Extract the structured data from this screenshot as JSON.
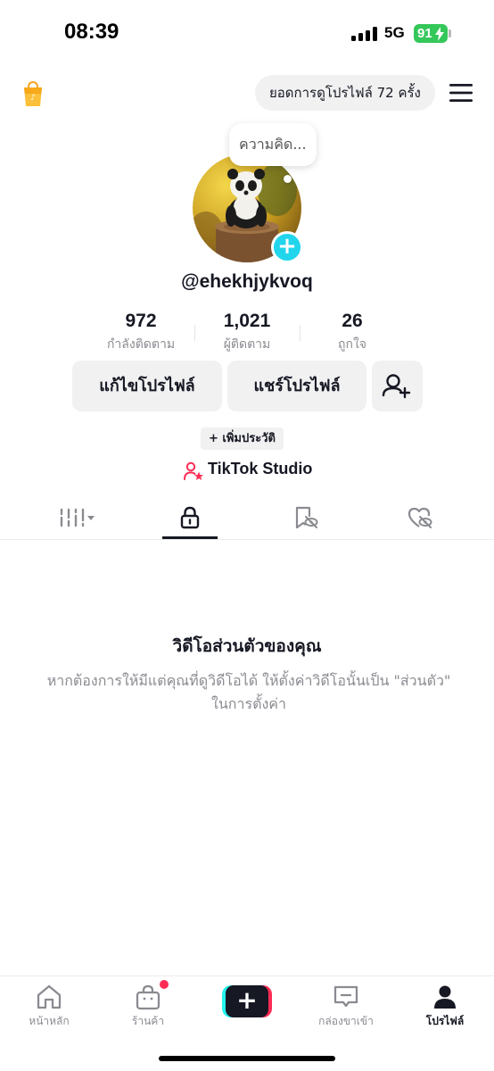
{
  "status_bar": {
    "time": "08:39",
    "network": "5G",
    "battery": "91"
  },
  "header": {
    "profile_views": "ยอดการดูโปรไฟล์ 72 ครั้ง"
  },
  "profile": {
    "thought_bubble": "ความคิด...",
    "username": "@ehekhjykvoq",
    "stats": [
      {
        "value": "972",
        "label": "กำลังติดตาม"
      },
      {
        "value": "1,021",
        "label": "ผู้ติดตาม"
      },
      {
        "value": "26",
        "label": "ถูกใจ"
      }
    ],
    "edit_profile_label": "แก้ไขโปรไฟล์",
    "share_profile_label": "แชร์โปรไฟล์",
    "add_bio_label": "+ เพิ่มประวัติ",
    "studio_label": "TikTok Studio"
  },
  "tabs": [
    {
      "icon": "grid-filter-icon",
      "active": false
    },
    {
      "icon": "lock-icon",
      "active": true
    },
    {
      "icon": "bookmark-hidden-icon",
      "active": false
    },
    {
      "icon": "heart-hidden-icon",
      "active": false
    }
  ],
  "empty_state": {
    "title": "วิดีโอส่วนตัวของคุณ",
    "description": "หากต้องการให้มีแต่คุณที่ดูวิดีโอได้ ให้ตั้งค่าวิดีโอนั้นเป็น \"ส่วนตัว\" ในการตั้งค่า"
  },
  "bottom_nav": {
    "items": [
      {
        "label": "หน้าหลัก",
        "icon": "home-icon"
      },
      {
        "label": "ร้านค้า",
        "icon": "shop-bag-icon"
      },
      {
        "label": "",
        "icon": "plus-icon"
      },
      {
        "label": "กล่องขาเข้า",
        "icon": "inbox-icon"
      },
      {
        "label": "โปรไฟล์",
        "icon": "profile-icon"
      }
    ],
    "active": "โปรไฟล์"
  },
  "colors": {
    "accent_cyan": "#20d5ec",
    "accent_red": "#fe2c55",
    "battery_green": "#34c759",
    "text_primary": "#161823",
    "text_secondary": "#8a8b91",
    "button_bg": "#f1f1f2"
  }
}
